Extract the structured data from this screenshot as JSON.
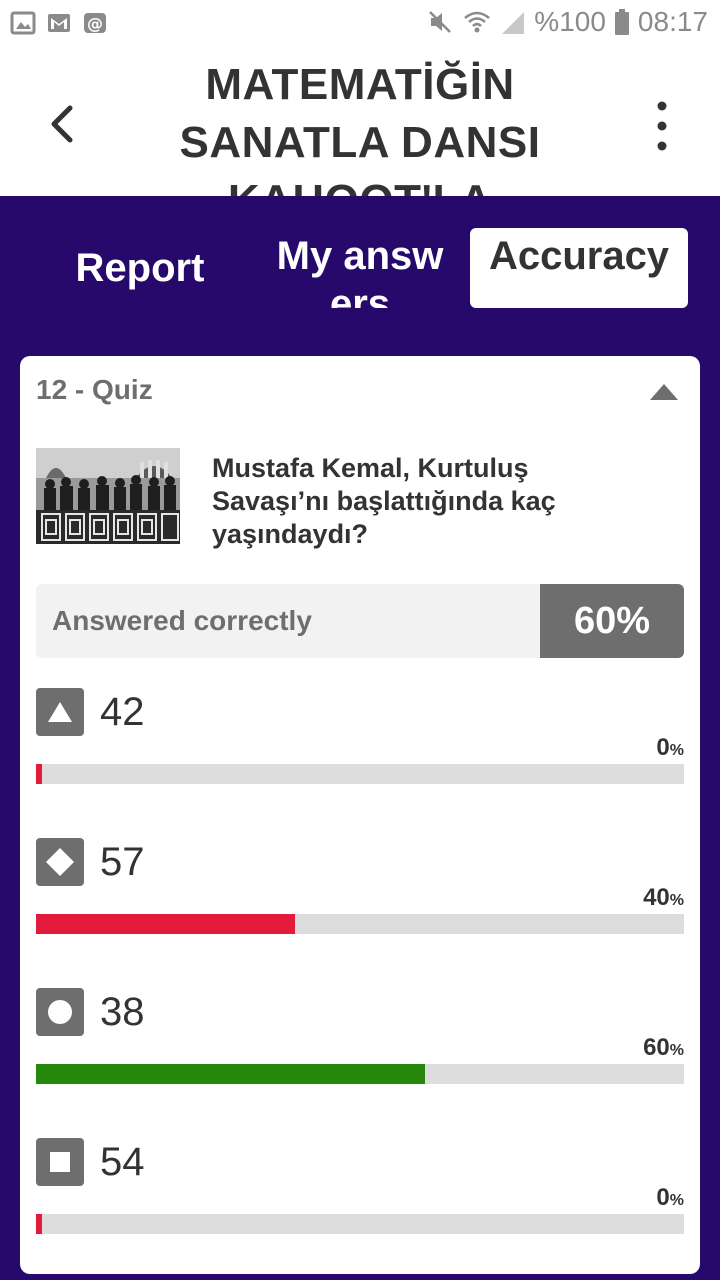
{
  "status_bar": {
    "battery": "%100",
    "time": "08:17"
  },
  "header": {
    "title": "MATEMATİĞİN SANATLA DANSI KAHOOT'LA"
  },
  "tabs": [
    {
      "label": "Report"
    },
    {
      "label": "My answers"
    },
    {
      "label": "Accuracy"
    }
  ],
  "card": {
    "quiz_label": "12 - Quiz",
    "question": "Mustafa Kemal, Kurtuluş Savaşı’nı başlattığında kaç yaşındaydı?",
    "answered_correctly_label": "Answered correctly",
    "answered_correctly_pct": "60%"
  },
  "answers": [
    {
      "shape": "triangle-icon",
      "text": "42",
      "pct_value": "0",
      "pct_sign": "%",
      "fraction": 0.0,
      "color": "#e21b3c"
    },
    {
      "shape": "diamond-icon",
      "text": "57",
      "pct_value": "40",
      "pct_sign": "%",
      "fraction": 0.4,
      "color": "#e21b3c"
    },
    {
      "shape": "circle-icon",
      "text": "38",
      "pct_value": "60",
      "pct_sign": "%",
      "fraction": 0.6,
      "color": "#26890c"
    },
    {
      "shape": "square-icon",
      "text": "54",
      "pct_value": "0",
      "pct_sign": "%",
      "fraction": 0.0,
      "color": "#e21b3c"
    }
  ],
  "colors": {
    "brand_purple": "#26096b",
    "wrong": "#e21b3c",
    "correct": "#26890c",
    "neutral": "#6e6e6e"
  }
}
